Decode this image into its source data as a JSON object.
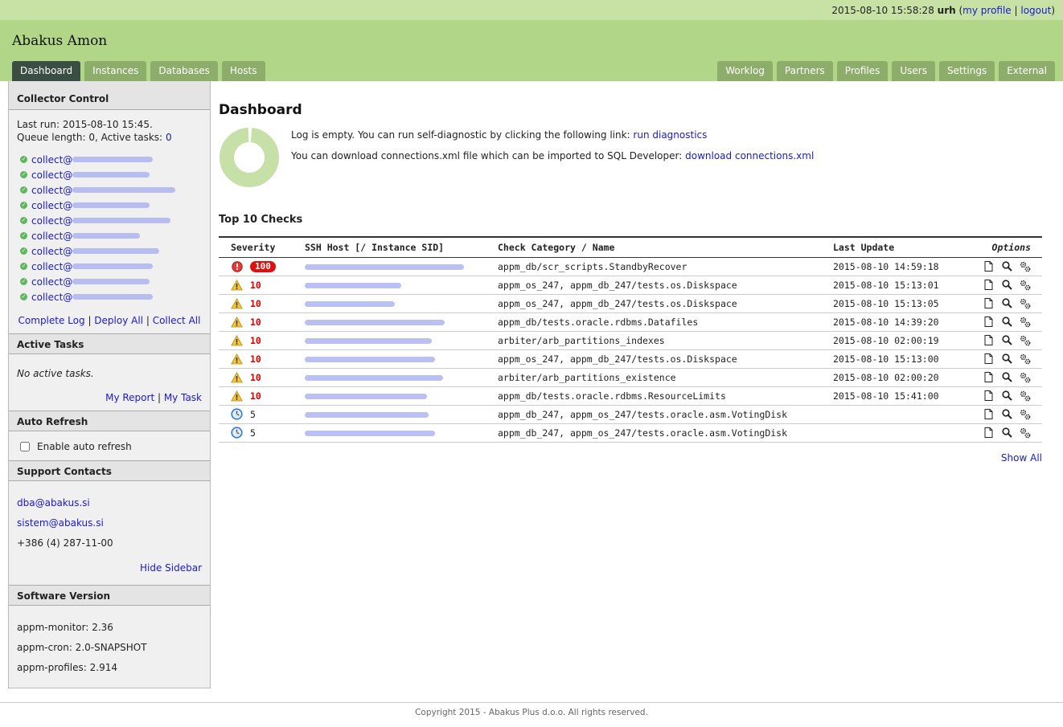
{
  "topbar": {
    "datetime": "2015-08-10 15:58:28",
    "user": "urh",
    "my_profile": "my profile",
    "logout": "logout"
  },
  "header": {
    "title": "Abakus Amon",
    "left_tabs": [
      "Dashboard",
      "Instances",
      "Databases",
      "Hosts"
    ],
    "right_tabs": [
      "Worklog",
      "Partners",
      "Profiles",
      "Users",
      "Settings",
      "External"
    ],
    "active_tab": "Dashboard"
  },
  "sidebar": {
    "collector_control": {
      "title": "Collector Control",
      "last_run_label": "Last run: 2015-08-10 15:45.",
      "queue_label": "Queue length: 0, Active tasks:",
      "active_tasks_value": "0",
      "collectors": [
        "collect@",
        "collect@",
        "collect@",
        "collect@",
        "collect@",
        "collect@",
        "collect@",
        "collect@",
        "collect@",
        "collect@"
      ],
      "complete_log": "Complete Log",
      "deploy_all": "Deploy All",
      "collect_all": "Collect All"
    },
    "active_tasks": {
      "title": "Active Tasks",
      "empty": "No active tasks.",
      "my_report": "My Report",
      "my_task": "My Task"
    },
    "auto_refresh": {
      "title": "Auto Refresh",
      "label": "Enable auto refresh",
      "checked": false
    },
    "support": {
      "title": "Support Contacts",
      "email1": "dba@abakus.si",
      "email2": "sistem@abakus.si",
      "phone": "+386 (4) 287-11-00",
      "hide_sidebar": "Hide Sidebar"
    },
    "software": {
      "title": "Software Version",
      "monitor": "appm-monitor: 2.36",
      "cron": "appm-cron: 2.0-SNAPSHOT",
      "profiles": "appm-profiles: 2.914"
    }
  },
  "main": {
    "title": "Dashboard",
    "log_text": "Log is empty. You can run self-diagnostic by clicking the following link:",
    "run_diagnostics": "run diagnostics",
    "download_text": "You can download connections.xml file which can be imported to SQL Developer:",
    "download_link": "download connections.xml",
    "top10_title": "Top 10 Checks",
    "columns": {
      "severity": "Severity",
      "host": "SSH Host [/ Instance SID]",
      "check": "Check Category / Name",
      "updated": "Last Update",
      "options": "Options"
    },
    "checks": [
      {
        "icon": "error",
        "severity": "100",
        "check": "appm_db/scr_scripts.StandbyRecover",
        "updated": "2015-08-10 14:59:18"
      },
      {
        "icon": "warning",
        "severity": "10",
        "check": "appm_os_247, appm_db_247/tests.os.Diskspace",
        "updated": "2015-08-10 15:13:01"
      },
      {
        "icon": "warning",
        "severity": "10",
        "check": "appm_os_247, appm_db_247/tests.os.Diskspace",
        "updated": "2015-08-10 15:13:05"
      },
      {
        "icon": "warning",
        "severity": "10",
        "check": "appm_db/tests.oracle.rdbms.Datafiles",
        "updated": "2015-08-10 14:39:20"
      },
      {
        "icon": "warning",
        "severity": "10",
        "check": "arbiter/arb_partitions_indexes",
        "updated": "2015-08-10 02:00:19"
      },
      {
        "icon": "warning",
        "severity": "10",
        "check": "appm_os_247, appm_db_247/tests.os.Diskspace",
        "updated": "2015-08-10 15:13:00"
      },
      {
        "icon": "warning",
        "severity": "10",
        "check": "arbiter/arb_partitions_existence",
        "updated": "2015-08-10 02:00:20"
      },
      {
        "icon": "warning",
        "severity": "10",
        "check": "appm_db/tests.oracle.rdbms.ResourceLimits",
        "updated": "2015-08-10 15:41:00"
      },
      {
        "icon": "clock",
        "severity": "5",
        "check": "appm_db_247, appm_os_247/tests.oracle.asm.VotingDisk",
        "updated": ""
      },
      {
        "icon": "clock",
        "severity": "5",
        "check": "appm_db_247, appm_os_247/tests.oracle.asm.VotingDisk",
        "updated": ""
      }
    ],
    "show_all": "Show All",
    "donut_fraction": 0.98
  },
  "footer": {
    "copyright": "Copyright 2015 - Abakus Plus d.o.o. All rights reserved."
  },
  "colors": {
    "topbar": "#c8e2a6",
    "header": "#b2d687",
    "tab": "#8cae6a",
    "tab_active": "#3b4e43",
    "link": "#1a1acc",
    "danger": "#e01010"
  }
}
